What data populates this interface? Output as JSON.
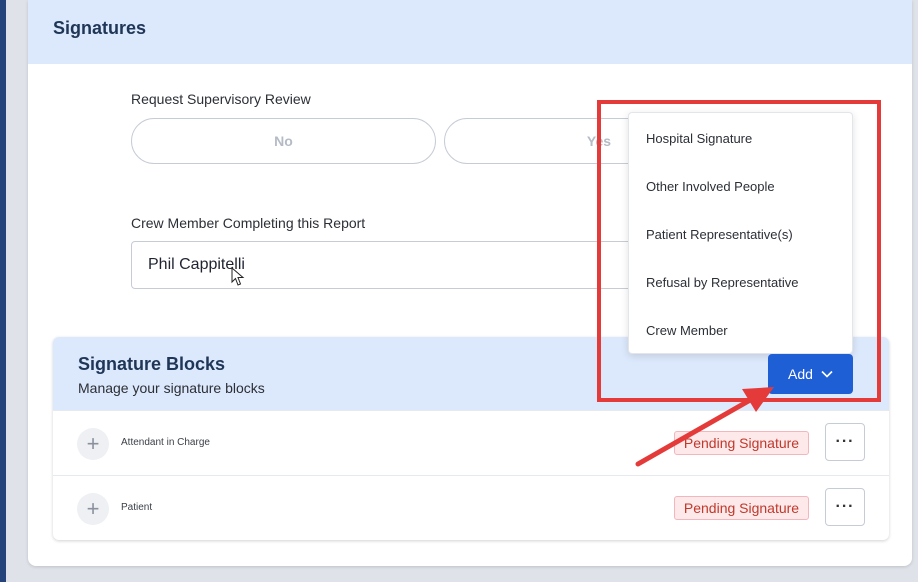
{
  "signatures": {
    "title": "Signatures",
    "supervisory_review": {
      "label": "Request Supervisory Review",
      "options": [
        "No",
        "Yes"
      ]
    },
    "crew_member": {
      "label": "Crew Member Completing this Report",
      "value": "Phil Cappitelli"
    }
  },
  "signature_blocks": {
    "title": "Signature Blocks",
    "subtitle": "Manage your signature blocks",
    "add_label": "Add",
    "rows": [
      {
        "label": "Attendant in Charge",
        "status": "Pending Signature"
      },
      {
        "label": "Patient",
        "status": "Pending Signature"
      }
    ]
  },
  "add_menu": {
    "items": [
      "Hospital Signature",
      "Other Involved People",
      "Patient Representative(s)",
      "Refusal by Representative",
      "Crew Member"
    ]
  },
  "colors": {
    "accent": "#1f5fd6",
    "header_bg": "#dce8fb",
    "annotation": "#e43a3a",
    "pending_text": "#c0392b"
  },
  "icons": {
    "row_add": "plus-icon",
    "row_more": "ellipsis-icon",
    "add_chevron": "chevron-down-icon",
    "pointer": "mouse-cursor-icon"
  }
}
